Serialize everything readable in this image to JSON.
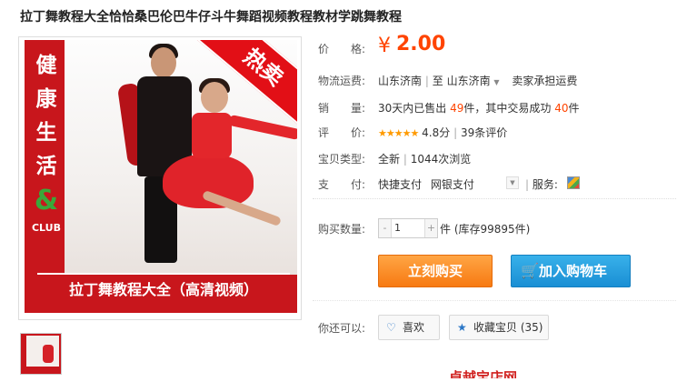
{
  "product": {
    "title": "拉丁舞教程大全恰恰桑巴伦巴牛仔斗牛舞蹈视频教程教材学跳舞教程"
  },
  "image": {
    "side_text_1": "健",
    "side_text_2": "康",
    "side_text_3": "生",
    "side_text_4": "活",
    "side_amp": "&",
    "side_club": "CLUB",
    "hot_badge": "热卖",
    "caption": "拉丁舞教程大全（高清视频）"
  },
  "price": {
    "label": "价　　格:",
    "currency": "¥",
    "value": "2.00"
  },
  "shipping": {
    "label": "物流运费:",
    "from": "山东济南",
    "sep": "|",
    "to_word": "至",
    "to": "山东济南",
    "note": "卖家承担运费"
  },
  "sales": {
    "label": "销　　量:",
    "prefix": "30天内已售出",
    "sold": "49",
    "mid": "件，其中交易成功",
    "success": "40",
    "suffix": "件"
  },
  "rating": {
    "label": "评　　价:",
    "stars": "★★★★★",
    "score": "4.8分",
    "sep": "|",
    "count": "39条评价"
  },
  "item_type": {
    "label": "宝贝类型:",
    "value": "全新",
    "sep": "|",
    "views": "1044次浏览"
  },
  "payment": {
    "label": "支　　付:",
    "method1": "快捷支付",
    "method2": "网银支付",
    "service_sep": "|",
    "service_label": "服务:"
  },
  "quantity": {
    "label": "购买数量:",
    "minus": "-",
    "value": "1",
    "plus": "+",
    "stock": "件 (库存99895件)"
  },
  "actions": {
    "buy_now": "立刻购买",
    "add_cart": "加入购物车",
    "cart_icon": "🛒"
  },
  "extra": {
    "label": "你还可以:",
    "like": "喜欢",
    "like_icon": "♡",
    "favorite": "收藏宝贝 (35)",
    "favorite_icon": "★"
  },
  "partial_text": "卓越宝店网"
}
